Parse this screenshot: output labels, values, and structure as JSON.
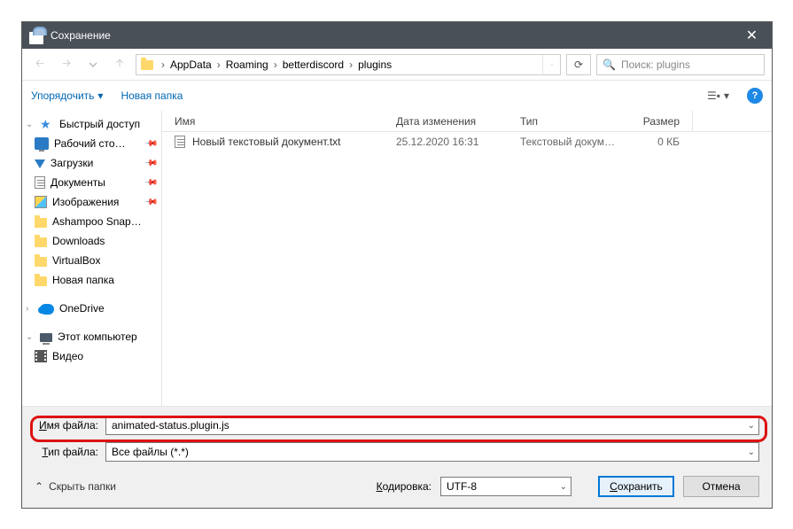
{
  "title": "Сохранение",
  "breadcrumb": [
    "AppData",
    "Roaming",
    "betterdiscord",
    "plugins"
  ],
  "search_placeholder": "Поиск: plugins",
  "toolbar": {
    "organize": "Упорядочить",
    "newfolder": "Новая папка"
  },
  "columns": {
    "name": "Имя",
    "date": "Дата изменения",
    "type": "Тип",
    "size": "Размер"
  },
  "sidebar": {
    "quick": "Быстрый доступ",
    "desktop": "Рабочий сто…",
    "downloads": "Загрузки",
    "documents": "Документы",
    "images": "Изображения",
    "ashampoo": "Ashampoo Snap…",
    "dl2": "Downloads",
    "vbox": "VirtualBox",
    "newf": "Новая папка",
    "onedrive": "OneDrive",
    "pc": "Этот компьютер",
    "video": "Видео"
  },
  "file": {
    "name": "Новый текстовый документ.txt",
    "date": "25.12.2020 16:31",
    "type": "Текстовый докум…",
    "size": "0 КБ"
  },
  "labels": {
    "filename": "Имя файла:",
    "filename_u": "И",
    "filetype": "Тип файла:",
    "filetype_u": "Т",
    "encoding": "Кодировка:",
    "encoding_u": "К",
    "hide": "Скрыть папки"
  },
  "values": {
    "filename": "animated-status.plugin.js",
    "filetype": "Все файлы (*.*)",
    "encoding": "UTF-8"
  },
  "buttons": {
    "save": "Сохранить",
    "save_u": "С",
    "cancel": "Отмена"
  }
}
